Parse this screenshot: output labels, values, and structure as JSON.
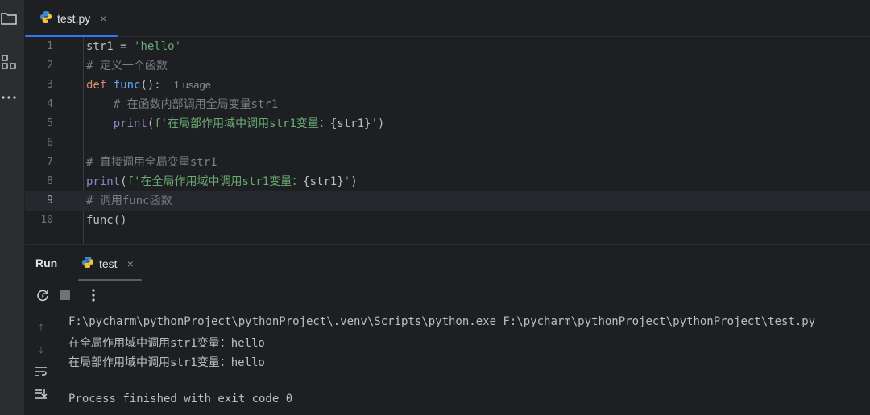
{
  "editor_tab": {
    "filename": "test.py",
    "close": "×"
  },
  "code_lines": [
    {
      "num": "1",
      "parts": [
        [
          "str1 = ",
          "br"
        ],
        [
          "'hello'",
          "str"
        ]
      ]
    },
    {
      "num": "2",
      "parts": [
        [
          "# 定义一个函数",
          "cm"
        ]
      ]
    },
    {
      "num": "3",
      "parts": [
        [
          "def ",
          "kw"
        ],
        [
          "func",
          "fn"
        ],
        [
          "():",
          "br"
        ]
      ],
      "hint": "1 usage"
    },
    {
      "num": "4",
      "parts": [
        [
          "    # 在函数内部调用全局变量str1",
          "cm"
        ]
      ]
    },
    {
      "num": "5",
      "parts": [
        [
          "    ",
          "br"
        ],
        [
          "print",
          "bi"
        ],
        [
          "(",
          "br"
        ],
        [
          "f'在局部作用域中调用str1变量：",
          "str"
        ],
        [
          "{str1}",
          "br"
        ],
        [
          "'",
          "str"
        ],
        [
          ")",
          "br"
        ]
      ]
    },
    {
      "num": "6",
      "parts": []
    },
    {
      "num": "7",
      "parts": [
        [
          "# 直接调用全局变量str1",
          "cm"
        ]
      ]
    },
    {
      "num": "8",
      "parts": [
        [
          "print",
          "bi"
        ],
        [
          "(",
          "br"
        ],
        [
          "f'在全局作用域中调用str1变量：",
          "str"
        ],
        [
          "{str1}",
          "br"
        ],
        [
          "'",
          "str"
        ],
        [
          ")",
          "br"
        ]
      ]
    },
    {
      "num": "9",
      "parts": [
        [
          "# 调用func函数",
          "cm"
        ]
      ],
      "current": true
    },
    {
      "num": "10",
      "parts": [
        [
          "func",
          "br"
        ],
        [
          "()",
          "br"
        ]
      ]
    }
  ],
  "run_panel": {
    "title": "Run",
    "tab_label": "test",
    "tab_close": "×"
  },
  "console": {
    "command": "F:\\pycharm\\pythonProject\\pythonProject\\.venv\\Scripts\\python.exe F:\\pycharm\\pythonProject\\pythonProject\\test.py",
    "line1": "在全局作用域中调用str1变量：hello",
    "line2": "在局部作用域中调用str1变量：hello",
    "finished": "Process finished with exit code 0"
  },
  "icons": {
    "folder": "folder-icon",
    "structure": "structure-icon",
    "more": "more-icon",
    "python": "python-icon",
    "rerun": "rerun-icon",
    "stop": "stop-icon",
    "up": "arrow-up-icon",
    "down": "arrow-down-icon",
    "wrap": "soft-wrap-icon",
    "scroll_end": "scroll-to-end-icon"
  },
  "colors": {
    "background": "#1e1f22",
    "accent": "#3574f0",
    "keyword": "#cf8e6d",
    "function": "#56a8f5",
    "string": "#6aab73",
    "comment": "#7a7e85"
  }
}
